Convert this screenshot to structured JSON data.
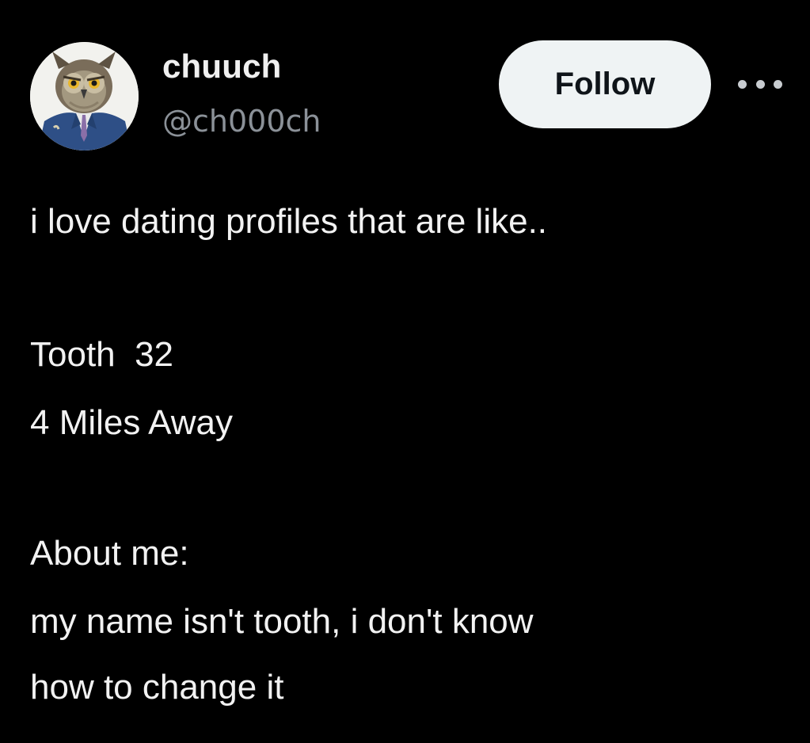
{
  "author": {
    "display_name": "chuuch",
    "handle": "@ch000ch",
    "avatar_icon": "owl-in-suit-avatar"
  },
  "actions": {
    "follow_label": "Follow",
    "more_icon": "more-horizontal-icon"
  },
  "tweet": {
    "line_1": "i love dating profiles that are like..",
    "line_2": "Tooth  32",
    "line_3": "4 Miles Away",
    "line_4": "About me:",
    "line_5": "my name isn't tooth, i don't know",
    "line_6": "how to change it"
  },
  "colors": {
    "background": "#000000",
    "text_primary": "#f2f2f2",
    "text_secondary": "#8b9198",
    "follow_bg": "#eff3f4",
    "follow_text": "#0f1419"
  }
}
